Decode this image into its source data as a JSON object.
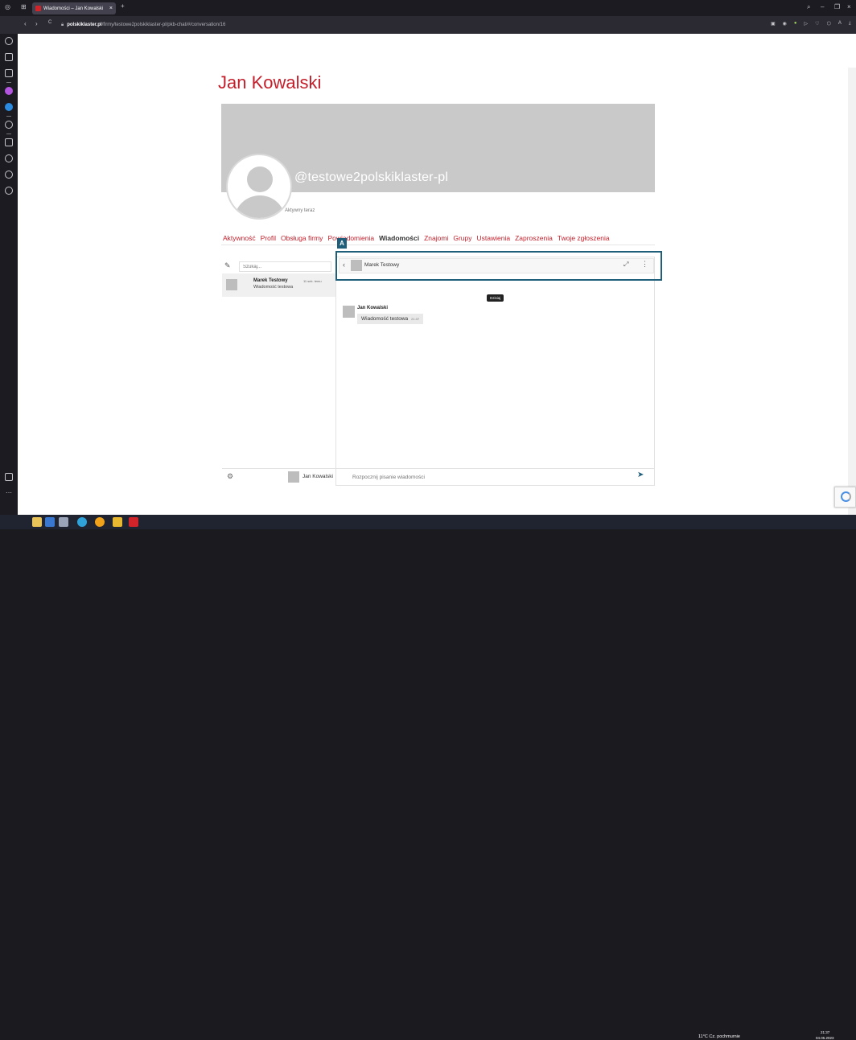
{
  "browser": {
    "tab_title": "Wiadomości – Jan Kowalski",
    "tab_close": "×",
    "new_tab": "+",
    "url_host": "polskiklaster.pl",
    "url_path": "/firmy/testowe2polskiklaster-pl/pkb-chat/#/conversation/16",
    "back": "‹",
    "forward": "›",
    "reload": "C",
    "win_min": "–",
    "win_max": "❐",
    "win_close": "×"
  },
  "profile": {
    "name": "Jan Kowalski",
    "handle": "@testowe2polskiklaster-pl",
    "status": "Aktywny teraz"
  },
  "nav": {
    "items": [
      "Aktywność",
      "Profil",
      "Obsługa firmy",
      "Powiadomienia",
      "Wiadomości",
      "Znajomi",
      "Grupy",
      "Ustawienia",
      "Zaproszenia",
      "Twoje zgłoszenia"
    ],
    "active_index": 4
  },
  "chat": {
    "search_placeholder": "Szukaj...",
    "conversations": [
      {
        "name": "Marek Testowy",
        "last_message": "Wiadomość testowa",
        "time": "11 sek. temu"
      }
    ],
    "current_user": "Jan Kowalski",
    "header_name": "Marek Testowy",
    "day_label": "Dzisiaj",
    "messages": [
      {
        "author": "Jan Kowalski",
        "text": "Wiadomość testowa",
        "time": "21:37"
      }
    ],
    "composer_placeholder": "Rozpocznij pisanie wiadomości"
  },
  "annotation": {
    "label": "A",
    "color": "#1f5f7a"
  },
  "taskbar": {
    "weather": "11°C Cz. pochmurnie",
    "time": "21:37",
    "date": "04.05.2023"
  },
  "colors": {
    "brand_red": "#c41e2a",
    "accent": "#1f5f7a"
  }
}
